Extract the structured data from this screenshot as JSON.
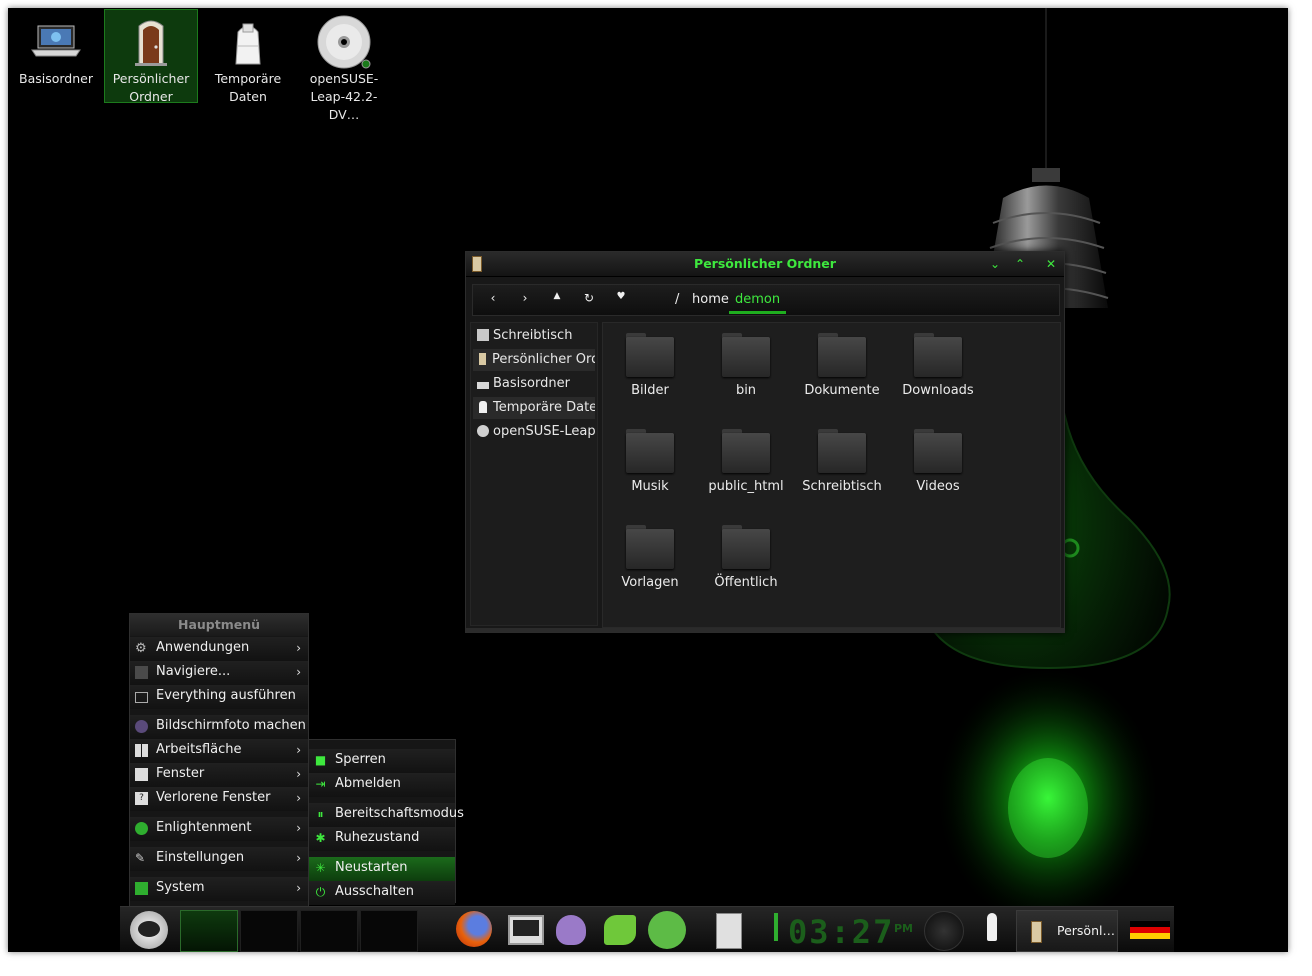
{
  "desktop": {
    "icons": [
      {
        "label_line1": "Basisordner",
        "label_line2": ""
      },
      {
        "label_line1": "Persönlicher",
        "label_line2": "Ordner"
      },
      {
        "label_line1": "Temporäre",
        "label_line2": "Daten"
      },
      {
        "label_line1": "openSUSE-",
        "label_line2": "Leap-42.2-DV…"
      }
    ]
  },
  "file_manager": {
    "title": "Persönlicher Ordner",
    "breadcrumb": {
      "root": "/",
      "home": "home",
      "current": "demon"
    },
    "sidebar": [
      {
        "label": "Schreibtisch"
      },
      {
        "label": "Persönlicher Ord…"
      },
      {
        "label": "Basisordner"
      },
      {
        "label": "Temporäre Daten"
      },
      {
        "label": "openSUSE-Leap…"
      }
    ],
    "folders": [
      {
        "name": "Bilder"
      },
      {
        "name": "bin"
      },
      {
        "name": "Dokumente"
      },
      {
        "name": "Downloads"
      },
      {
        "name": "Musik"
      },
      {
        "name": "public_html"
      },
      {
        "name": "Schreibtisch"
      },
      {
        "name": "Videos"
      },
      {
        "name": "Vorlagen"
      },
      {
        "name": "Öffentlich"
      }
    ]
  },
  "main_menu": {
    "title": "Hauptmenü",
    "items": [
      {
        "label": "Anwendungen"
      },
      {
        "label": "Navigiere..."
      },
      {
        "label": "Everything ausführen"
      },
      {
        "label": "Bildschirmfoto machen"
      },
      {
        "label": "Arbeitsfläche"
      },
      {
        "label": "Fenster"
      },
      {
        "label": "Verlorene Fenster"
      },
      {
        "label": "Enlightenment"
      },
      {
        "label": "Einstellungen"
      },
      {
        "label": "System"
      }
    ]
  },
  "system_submenu": {
    "items": [
      {
        "label": "Sperren"
      },
      {
        "label": "Abmelden"
      },
      {
        "label": "Bereitschaftsmodus"
      },
      {
        "label": "Ruhezustand"
      },
      {
        "label": "Neustarten"
      },
      {
        "label": "Ausschalten"
      }
    ],
    "selected": "Neustarten"
  },
  "shelf": {
    "clock": "03:27",
    "clock_ampm": "PM",
    "task_label": "Persönl…",
    "keyboard_layout": "de"
  },
  "colors": {
    "accent": "#3ee83e",
    "background": "#000000"
  }
}
